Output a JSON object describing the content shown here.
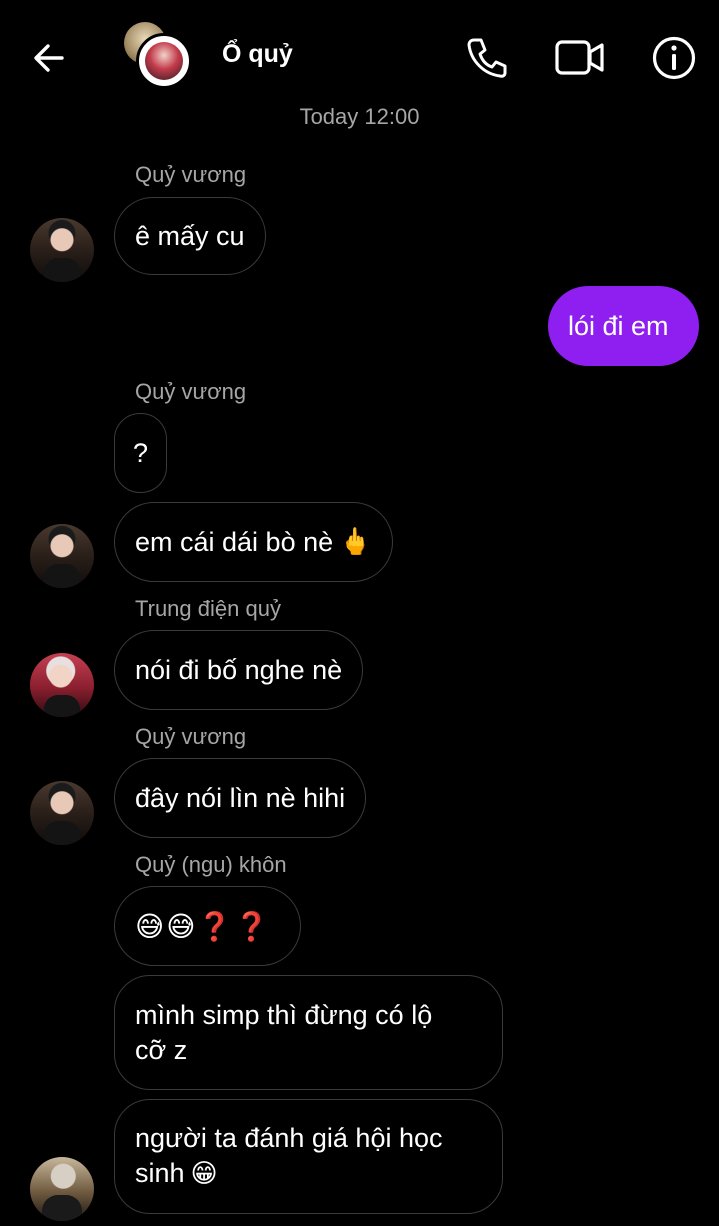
{
  "header": {
    "title": "Ổ quỷ",
    "back_icon": "arrow-left-icon",
    "call_icon": "phone-icon",
    "video_icon": "video-camera-icon",
    "info_icon": "info-icon"
  },
  "timestamp": "Today 12:00",
  "colors": {
    "background": "#000000",
    "my_bubble": "#8f1ff0",
    "bubble_border": "#3a3a3a",
    "secondary_text": "#a6a6a6"
  },
  "messages": [
    {
      "sender": "Quỷ vương",
      "text": "ê mấy cu"
    },
    {
      "sender": "me",
      "text": "lói đi em"
    },
    {
      "sender": "Quỷ vương",
      "text": "?"
    },
    {
      "sender": "Quỷ vương",
      "text": "em cái dái bò nè",
      "emoji": "🖕"
    },
    {
      "sender": "Trung điện quỷ",
      "text": "nói đi bố nghe nè"
    },
    {
      "sender": "Quỷ vương",
      "text": "đây nói lìn nè hihi"
    },
    {
      "sender": "Quỷ (ngu) khôn",
      "text": "",
      "emoji": "😅😅❓❓"
    },
    {
      "sender": "Quỷ (ngu) khôn",
      "lines": [
        "mình simp thì đừng có lộ",
        "cỡ z"
      ]
    },
    {
      "sender": "Quỷ (ngu) khôn",
      "lines": [
        "người ta đánh giá hội học",
        "sinh"
      ],
      "emoji": "😁"
    }
  ]
}
